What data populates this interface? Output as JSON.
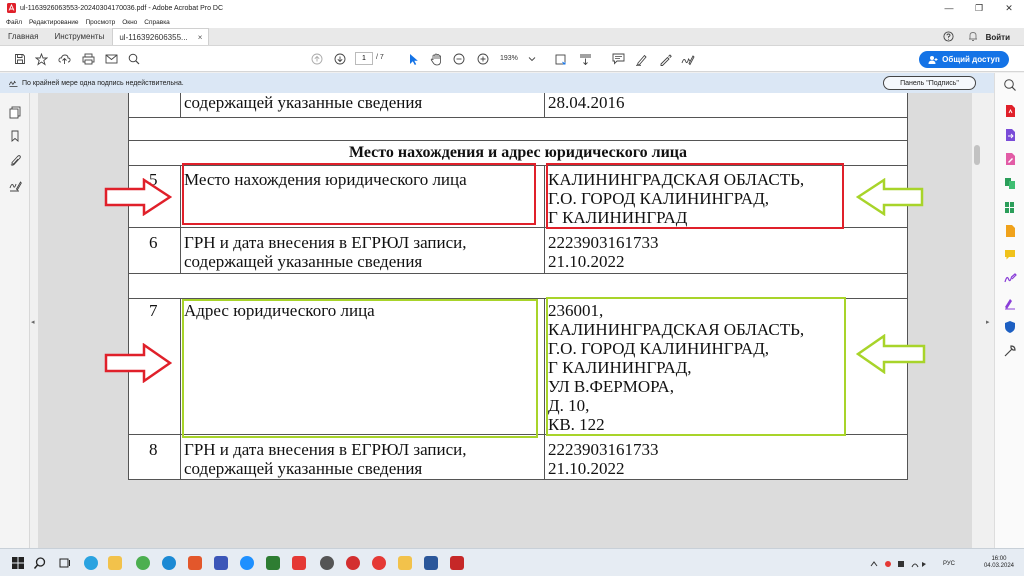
{
  "window": {
    "title": "ul-1163926063553-20240304170036.pdf - Adobe Acrobat Pro DC",
    "controls": [
      "—",
      "❐",
      "✕"
    ]
  },
  "menu": [
    "Файл",
    "Редактирование",
    "Просмотр",
    "Окно",
    "Справка"
  ],
  "tabs": {
    "home": "Главная",
    "tools": "Инструменты",
    "document": "ul-116392606355...",
    "close": "×"
  },
  "account": {
    "signin": "Войти"
  },
  "toolbar": {
    "page_current": "1",
    "page_total": "/ 7",
    "zoom": "193%",
    "share_label": "Общий доступ"
  },
  "banner": {
    "message": "По крайней мере одна подпись недействительна.",
    "panel_button": "Панель \"Подпись\""
  },
  "document": {
    "rows": [
      {
        "num": "",
        "label": "содержащей указанные сведения",
        "value": "28.04.2016"
      },
      {
        "section": "Место нахождения и адрес юридического лица"
      },
      {
        "num": "5",
        "label": "Место нахождения юридического лица",
        "value": "КАЛИНИНГРАДСКАЯ ОБЛАСТЬ,\nГ.О. ГОРОД КАЛИНИНГРАД,\nГ КАЛИНИНГРАД"
      },
      {
        "num": "6",
        "label": "ГРН и дата внесения в ЕГРЮЛ записи,\nсодержащей указанные сведения",
        "value": "2223903161733\n21.10.2022"
      },
      {
        "num": "7",
        "label": "Адрес юридического лица",
        "value": "236001,\nКАЛИНИНГРАДСКАЯ ОБЛАСТЬ,\nГ.О. ГОРОД КАЛИНИНГРАД,\nГ КАЛИНИНГРАД,\nУЛ В.ФЕРМОРА,\nД. 10,\nКВ. 122"
      },
      {
        "num": "8",
        "label": "ГРН и дата внесения в ЕГРЮЛ записи,\nсодержащей указанные сведения",
        "value": "2223903161733\n21.10.2022"
      }
    ]
  },
  "taskbar": {
    "clock_time": "16:00",
    "clock_date": "04.03.2024",
    "lang": "РУС"
  },
  "colors": {
    "red_highlight": "#e0202a",
    "green_highlight": "#a8d42a",
    "accent": "#1473e6"
  }
}
